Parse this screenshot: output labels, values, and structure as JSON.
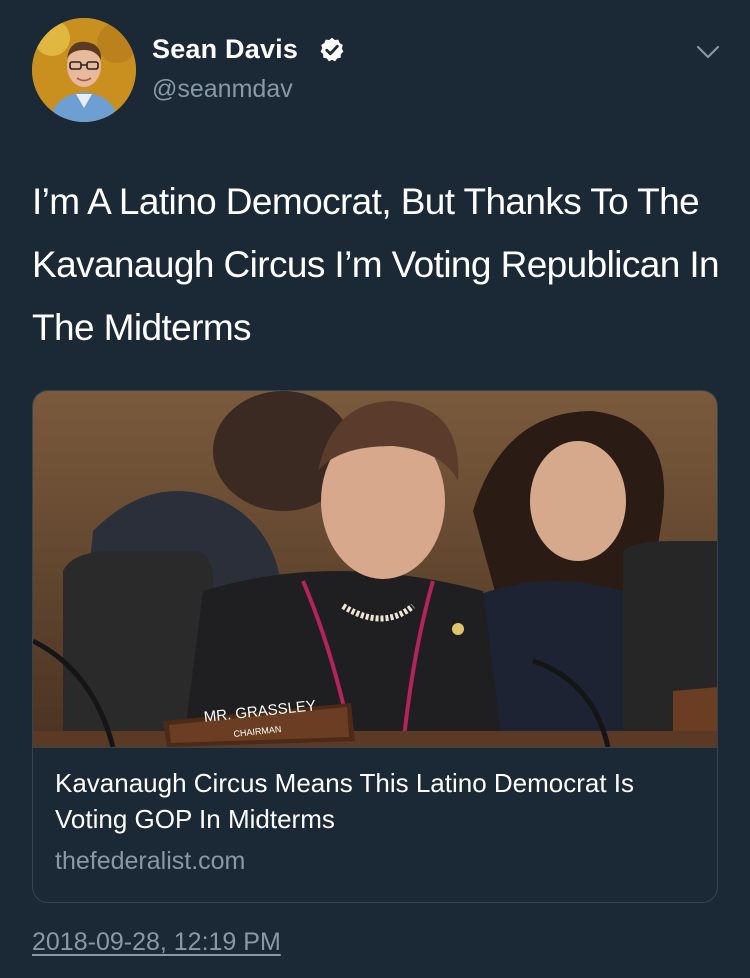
{
  "author": {
    "name": "Sean Davis",
    "handle": "@seanmdav",
    "verified": true,
    "avatar_icon": "user-avatar-photo"
  },
  "menu_icon": "chevron-down-icon",
  "tweet": {
    "text": "I’m A Latino Democrat, But Thanks To The Kavanaugh Circus I’m Voting Republican In The Midterms"
  },
  "card": {
    "image_caption_plate": "MR. GRASSLEY",
    "image_caption_sub": "CHAIRMAN",
    "title": "Kavanaugh Circus Means This Latino Democrat Is Voting GOP In Midterms",
    "domain": "thefederalist.com"
  },
  "timestamp": "2018-09-28, 12:19 PM",
  "colors": {
    "background": "#1b2836",
    "text_primary": "#ffffff",
    "text_secondary": "#8899a6",
    "verified_badge": "#ffffff",
    "border": "#38444d"
  }
}
